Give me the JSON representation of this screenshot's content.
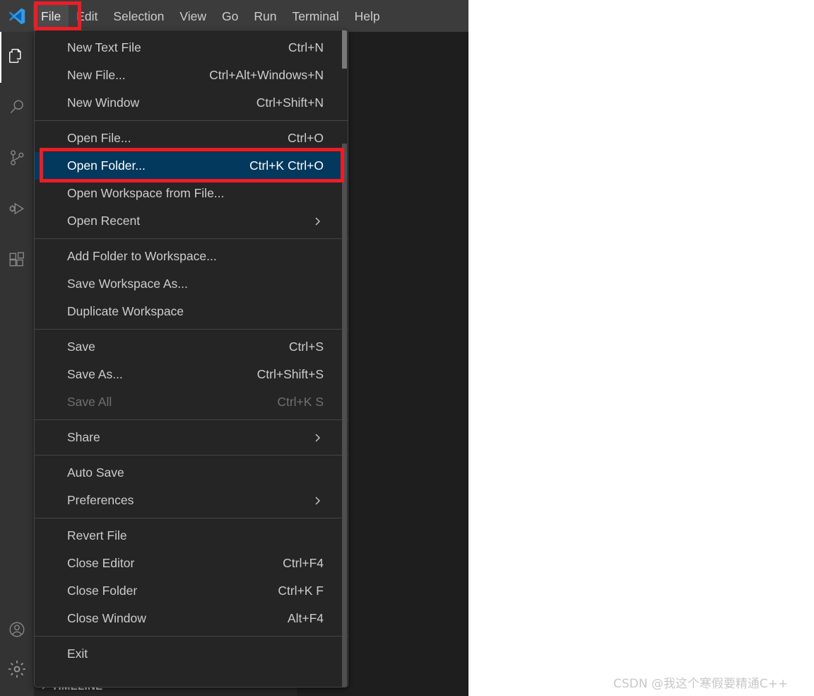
{
  "app": {
    "name": "Visual Studio Code",
    "logo_icon": "vscode-logo-icon"
  },
  "menubar": {
    "items": [
      {
        "label": "File",
        "active": true
      },
      {
        "label": "Edit",
        "active": false
      },
      {
        "label": "Selection",
        "active": false
      },
      {
        "label": "View",
        "active": false
      },
      {
        "label": "Go",
        "active": false
      },
      {
        "label": "Run",
        "active": false
      },
      {
        "label": "Terminal",
        "active": false
      },
      {
        "label": "Help",
        "active": false
      }
    ]
  },
  "activitybar": {
    "top_items": [
      {
        "name": "explorer-icon",
        "tooltip": "Explorer",
        "active": true
      },
      {
        "name": "search-icon",
        "tooltip": "Search",
        "active": false
      },
      {
        "name": "source-control-icon",
        "tooltip": "Source Control",
        "active": false
      },
      {
        "name": "run-and-debug-icon",
        "tooltip": "Run and Debug",
        "active": false
      },
      {
        "name": "extensions-icon",
        "tooltip": "Extensions",
        "active": false
      }
    ],
    "bottom_items": [
      {
        "name": "account-icon",
        "tooltip": "Accounts"
      },
      {
        "name": "settings-gear-icon",
        "tooltip": "Manage"
      }
    ]
  },
  "sidebar": {
    "sections": [
      {
        "label": "TIMELINE",
        "expanded": false,
        "chevron": "chevron-right-icon"
      }
    ]
  },
  "file_menu": {
    "groups": [
      {
        "items": [
          {
            "label": "New Text File",
            "keybinding": "Ctrl+N",
            "disabled": false,
            "selected": false,
            "submenu": false
          },
          {
            "label": "New File...",
            "keybinding": "Ctrl+Alt+Windows+N",
            "disabled": false,
            "selected": false,
            "submenu": false
          },
          {
            "label": "New Window",
            "keybinding": "Ctrl+Shift+N",
            "disabled": false,
            "selected": false,
            "submenu": false
          }
        ]
      },
      {
        "items": [
          {
            "label": "Open File...",
            "keybinding": "Ctrl+O",
            "disabled": false,
            "selected": false,
            "submenu": false
          },
          {
            "label": "Open Folder...",
            "keybinding": "Ctrl+K Ctrl+O",
            "disabled": false,
            "selected": true,
            "submenu": false
          },
          {
            "label": "Open Workspace from File...",
            "keybinding": "",
            "disabled": false,
            "selected": false,
            "submenu": false
          },
          {
            "label": "Open Recent",
            "keybinding": "",
            "disabled": false,
            "selected": false,
            "submenu": true
          }
        ]
      },
      {
        "items": [
          {
            "label": "Add Folder to Workspace...",
            "keybinding": "",
            "disabled": false,
            "selected": false,
            "submenu": false
          },
          {
            "label": "Save Workspace As...",
            "keybinding": "",
            "disabled": false,
            "selected": false,
            "submenu": false
          },
          {
            "label": "Duplicate Workspace",
            "keybinding": "",
            "disabled": false,
            "selected": false,
            "submenu": false
          }
        ]
      },
      {
        "items": [
          {
            "label": "Save",
            "keybinding": "Ctrl+S",
            "disabled": false,
            "selected": false,
            "submenu": false
          },
          {
            "label": "Save As...",
            "keybinding": "Ctrl+Shift+S",
            "disabled": false,
            "selected": false,
            "submenu": false
          },
          {
            "label": "Save All",
            "keybinding": "Ctrl+K S",
            "disabled": true,
            "selected": false,
            "submenu": false
          }
        ]
      },
      {
        "items": [
          {
            "label": "Share",
            "keybinding": "",
            "disabled": false,
            "selected": false,
            "submenu": true
          }
        ]
      },
      {
        "items": [
          {
            "label": "Auto Save",
            "keybinding": "",
            "disabled": false,
            "selected": false,
            "submenu": false
          },
          {
            "label": "Preferences",
            "keybinding": "",
            "disabled": false,
            "selected": false,
            "submenu": true
          }
        ]
      },
      {
        "items": [
          {
            "label": "Revert File",
            "keybinding": "",
            "disabled": false,
            "selected": false,
            "submenu": false
          },
          {
            "label": "Close Editor",
            "keybinding": "Ctrl+F4",
            "disabled": false,
            "selected": false,
            "submenu": false
          },
          {
            "label": "Close Folder",
            "keybinding": "Ctrl+K F",
            "disabled": false,
            "selected": false,
            "submenu": false
          },
          {
            "label": "Close Window",
            "keybinding": "Alt+F4",
            "disabled": false,
            "selected": false,
            "submenu": false
          }
        ]
      },
      {
        "items": [
          {
            "label": "Exit",
            "keybinding": "",
            "disabled": false,
            "selected": false,
            "submenu": false
          }
        ]
      }
    ]
  },
  "annotations": [
    {
      "name": "file-menu-highlight",
      "target": "File",
      "color": "#ee1c25"
    },
    {
      "name": "open-folder-highlight",
      "target": "Open Folder...",
      "color": "#ee1c25"
    }
  ],
  "watermark": {
    "text": "CSDN @我这个寒假要精通C++"
  },
  "colors": {
    "titlebar_bg": "#3c3c3c",
    "activitybar_bg": "#333333",
    "sidebar_bg": "#252526",
    "editor_bg": "#1e1e1e",
    "menu_bg": "#252526",
    "menu_selected_bg": "#04395e",
    "annotation_red": "#ee1c25",
    "text_primary": "#cccccc",
    "text_disabled": "#707070"
  }
}
